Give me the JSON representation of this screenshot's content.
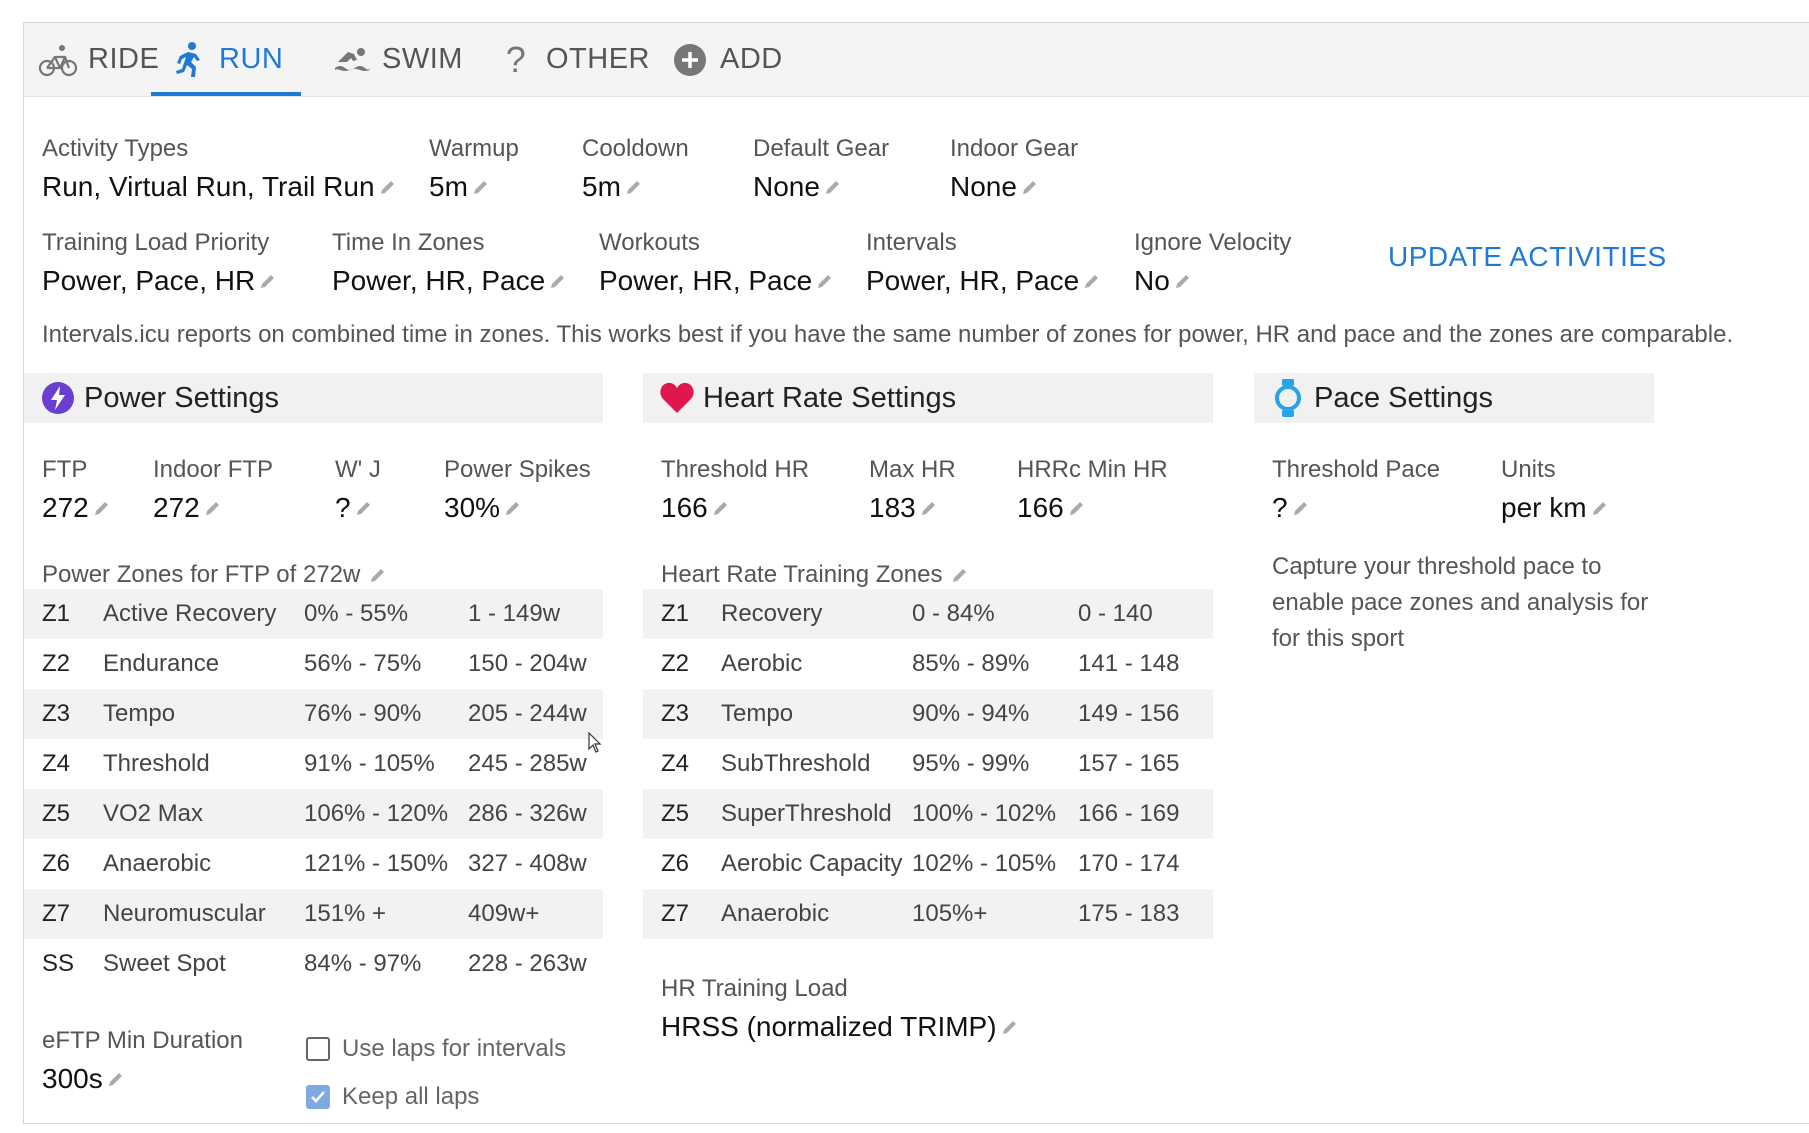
{
  "tabs": [
    {
      "label": "RIDE",
      "icon": "bicycle-icon"
    },
    {
      "label": "RUN",
      "icon": "runner-icon",
      "active": true
    },
    {
      "label": "SWIM",
      "icon": "swimmer-icon"
    },
    {
      "label": "OTHER",
      "icon": "question-icon"
    },
    {
      "label": "ADD",
      "icon": "add-circle-icon"
    }
  ],
  "top_fields": {
    "activity_types": {
      "label": "Activity Types",
      "value": "Run, Virtual Run, Trail Run"
    },
    "warmup": {
      "label": "Warmup",
      "value": "5m"
    },
    "cooldown": {
      "label": "Cooldown",
      "value": "5m"
    },
    "default_gear": {
      "label": "Default Gear",
      "value": "None"
    },
    "indoor_gear": {
      "label": "Indoor Gear",
      "value": "None"
    },
    "training_load_priority": {
      "label": "Training Load Priority",
      "value": "Power, Pace, HR"
    },
    "time_in_zones": {
      "label": "Time In Zones",
      "value": "Power, HR, Pace"
    },
    "workouts": {
      "label": "Workouts",
      "value": "Power, HR, Pace"
    },
    "intervals": {
      "label": "Intervals",
      "value": "Power, HR, Pace"
    },
    "ignore_velocity": {
      "label": "Ignore Velocity",
      "value": "No"
    }
  },
  "update_activities_label": "UPDATE ACTIVITIES",
  "zones_note": "Intervals.icu reports on combined time in zones. This works best if you have the same number of zones for power, HR and pace and the zones are comparable.",
  "power": {
    "title": "Power Settings",
    "fields": [
      {
        "label": "FTP",
        "value": "272"
      },
      {
        "label": "Indoor FTP",
        "value": "272"
      },
      {
        "label": "W' J",
        "value": "?"
      },
      {
        "label": "Power Spikes",
        "value": "30%"
      }
    ],
    "zones_title": "Power Zones for FTP of 272w",
    "zones": [
      [
        "Z1",
        "Active Recovery",
        "0% - 55%",
        "1 - 149w"
      ],
      [
        "Z2",
        "Endurance",
        "56% - 75%",
        "150 - 204w"
      ],
      [
        "Z3",
        "Tempo",
        "76% - 90%",
        "205 - 244w"
      ],
      [
        "Z4",
        "Threshold",
        "91% - 105%",
        "245 - 285w"
      ],
      [
        "Z5",
        "VO2 Max",
        "106% - 120%",
        "286 - 326w"
      ],
      [
        "Z6",
        "Anaerobic",
        "121% - 150%",
        "327 - 408w"
      ],
      [
        "Z7",
        "Neuromuscular",
        "151% +",
        "409w+"
      ],
      [
        "SS",
        "Sweet Spot",
        "84% - 97%",
        "228 - 263w"
      ]
    ],
    "eftp": {
      "label": "eFTP Min Duration",
      "value": "300s"
    },
    "use_laps_label": "Use laps for intervals",
    "use_laps_checked": false,
    "keep_laps_label": "Keep all laps",
    "keep_laps_checked": true
  },
  "hr": {
    "title": "Heart Rate Settings",
    "fields": [
      {
        "label": "Threshold HR",
        "value": "166"
      },
      {
        "label": "Max HR",
        "value": "183"
      },
      {
        "label": "HRRc Min HR",
        "value": "166"
      }
    ],
    "zones_title": "Heart Rate Training Zones",
    "zones": [
      [
        "Z1",
        "Recovery",
        "0 - 84%",
        "0 - 140"
      ],
      [
        "Z2",
        "Aerobic",
        "85% - 89%",
        "141 - 148"
      ],
      [
        "Z3",
        "Tempo",
        "90% - 94%",
        "149 - 156"
      ],
      [
        "Z4",
        "SubThreshold",
        "95% - 99%",
        "157 - 165"
      ],
      [
        "Z5",
        "SuperThreshold",
        "100% - 102%",
        "166 - 169"
      ],
      [
        "Z6",
        "Aerobic Capacity",
        "102% - 105%",
        "170 - 174"
      ],
      [
        "Z7",
        "Anaerobic",
        "105%+",
        "175 - 183"
      ]
    ],
    "load": {
      "label": "HR Training Load",
      "value": "HRSS (normalized TRIMP)"
    }
  },
  "pace": {
    "title": "Pace Settings",
    "fields": [
      {
        "label": "Threshold Pace",
        "value": "?"
      },
      {
        "label": "Units",
        "value": "per km"
      }
    ],
    "note_lines": [
      "Capture your threshold pace to",
      "enable pace zones and analysis for",
      "for this sport"
    ]
  },
  "colors": {
    "accent": "#1e7ad6",
    "power_icon": "#6a3fd0",
    "heart_icon": "#e0174f",
    "pace_icon": "#29a3e6"
  }
}
